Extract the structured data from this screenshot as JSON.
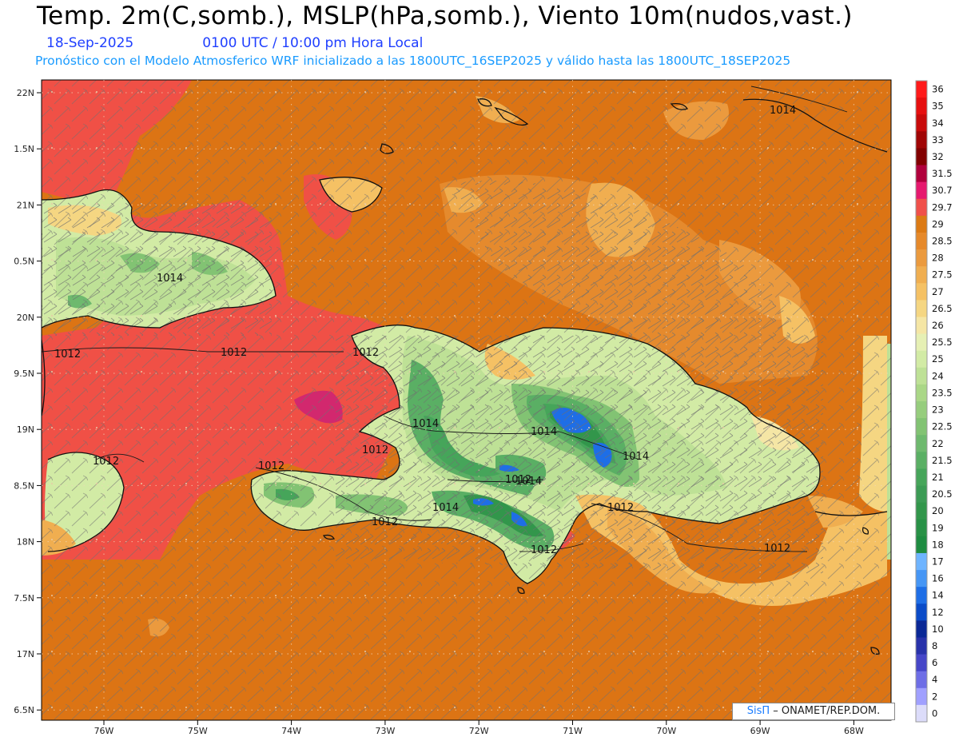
{
  "header": {
    "title": "Temp. 2m(C,somb.), MSLP(hPa,somb.), Viento 10m(nudos,vast.)",
    "date": "18-Sep-2025",
    "time": "0100 UTC / 10:00 pm Hora Local",
    "model_info": "Pronóstico con el Modelo Atmosferico WRF inicializado a las 1800UTC_16SEP2025 y válido hasta las  1800UTC_18SEP2025"
  },
  "axes": {
    "lat_labels": [
      "22N",
      "1.5N",
      "21N",
      "0.5N",
      "20N",
      "9.5N",
      "19N",
      "8.5N",
      "18N",
      "7.5N",
      "17N",
      "6.5N"
    ],
    "lon_labels": [
      "76W",
      "75W",
      "74W",
      "73W",
      "72W",
      "71W",
      "70W",
      "69W",
      "68W"
    ]
  },
  "isobars": [
    {
      "label": "1014"
    },
    {
      "label": "1014"
    },
    {
      "label": "1012"
    },
    {
      "label": "1012"
    },
    {
      "label": "1012"
    },
    {
      "label": "1014"
    },
    {
      "label": "1012"
    },
    {
      "label": "1012"
    },
    {
      "label": "1012"
    },
    {
      "label": "1014"
    },
    {
      "label": "1014"
    },
    {
      "label": "1014"
    },
    {
      "label": "1014"
    },
    {
      "label": "1012"
    },
    {
      "label": "1012"
    },
    {
      "label": "1012"
    },
    {
      "label": "1012"
    },
    {
      "label": "1012"
    }
  ],
  "colorbar": {
    "levels": [
      {
        "label": "36",
        "color": "#ff1a1a"
      },
      {
        "label": "35",
        "color": "#e60f0f"
      },
      {
        "label": "34",
        "color": "#c80a0a"
      },
      {
        "label": "33",
        "color": "#a00505"
      },
      {
        "label": "32",
        "color": "#820000"
      },
      {
        "label": "31.5",
        "color": "#b0003c"
      },
      {
        "label": "30.7",
        "color": "#e6196e"
      },
      {
        "label": "29.7",
        "color": "#f0504a"
      },
      {
        "label": "29",
        "color": "#dc7a14"
      },
      {
        "label": "28.5",
        "color": "#e6892a"
      },
      {
        "label": "28",
        "color": "#eb9a3e"
      },
      {
        "label": "27.5",
        "color": "#f0ae50"
      },
      {
        "label": "27",
        "color": "#f5c164"
      },
      {
        "label": "26.5",
        "color": "#f5d682"
      },
      {
        "label": "26",
        "color": "#f5e6a5"
      },
      {
        "label": "25.5",
        "color": "#e6f0b4"
      },
      {
        "label": "25",
        "color": "#d2eba5"
      },
      {
        "label": "24",
        "color": "#bee196"
      },
      {
        "label": "23.5",
        "color": "#aad787"
      },
      {
        "label": "23",
        "color": "#96cd7d"
      },
      {
        "label": "22.5",
        "color": "#82c373"
      },
      {
        "label": "22",
        "color": "#6eb96e"
      },
      {
        "label": "21.5",
        "color": "#5aaf64"
      },
      {
        "label": "21",
        "color": "#46a55a"
      },
      {
        "label": "20.5",
        "color": "#3c9b55"
      },
      {
        "label": "20",
        "color": "#32964b"
      },
      {
        "label": "19",
        "color": "#289146"
      },
      {
        "label": "18",
        "color": "#1e8c41"
      },
      {
        "label": "17",
        "color": "#6eb4ff"
      },
      {
        "label": "16",
        "color": "#4696f5"
      },
      {
        "label": "14",
        "color": "#1e6ee6"
      },
      {
        "label": "12",
        "color": "#0a4bc8"
      },
      {
        "label": "10",
        "color": "#0a2896"
      },
      {
        "label": "8",
        "color": "#2832aa"
      },
      {
        "label": "6",
        "color": "#4646c8"
      },
      {
        "label": "4",
        "color": "#6e6ee6"
      },
      {
        "label": "2",
        "color": "#a0a0ff"
      },
      {
        "label": "0",
        "color": "#dcdcfa"
      }
    ]
  },
  "colors": {
    "sea": "#dc7414",
    "hot_sea": "#f05046",
    "hot_core": "#d2286e",
    "vapor": "#e68c2c"
  },
  "credit": {
    "brand": "SisΠ",
    "text": "– ONAMET/REP.DOM."
  }
}
